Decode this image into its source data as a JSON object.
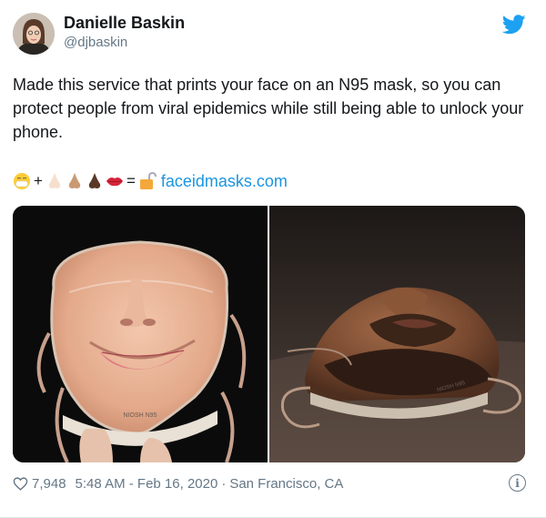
{
  "author": {
    "name": "Danielle Baskin",
    "handle": "@djbaskin"
  },
  "tweet": {
    "text": "Made this service that prints your face on an N95 mask, so you can protect people from viral epidemics while still being able to unlock your phone.",
    "emoji_icons": [
      "mask-face-emoji",
      "light-skin-nose-emoji",
      "medium-skin-nose-emoji",
      "dark-skin-nose-emoji",
      "lips-emoji",
      "unlocked-padlock-emoji"
    ],
    "plus": "+",
    "equals": "=",
    "link": "faceidmasks.com"
  },
  "media": {
    "left_mask_label": "NIOSH N95",
    "right_mask_label": "NIOSH N95"
  },
  "footer": {
    "likes": "7,948",
    "timestamp": "5:48 AM - Feb 16, 2020",
    "separator": "·",
    "location": "San Francisco, CA"
  },
  "colors": {
    "brand": "#1da1f2",
    "link": "#1b95e0",
    "secondary_text": "#657786"
  }
}
